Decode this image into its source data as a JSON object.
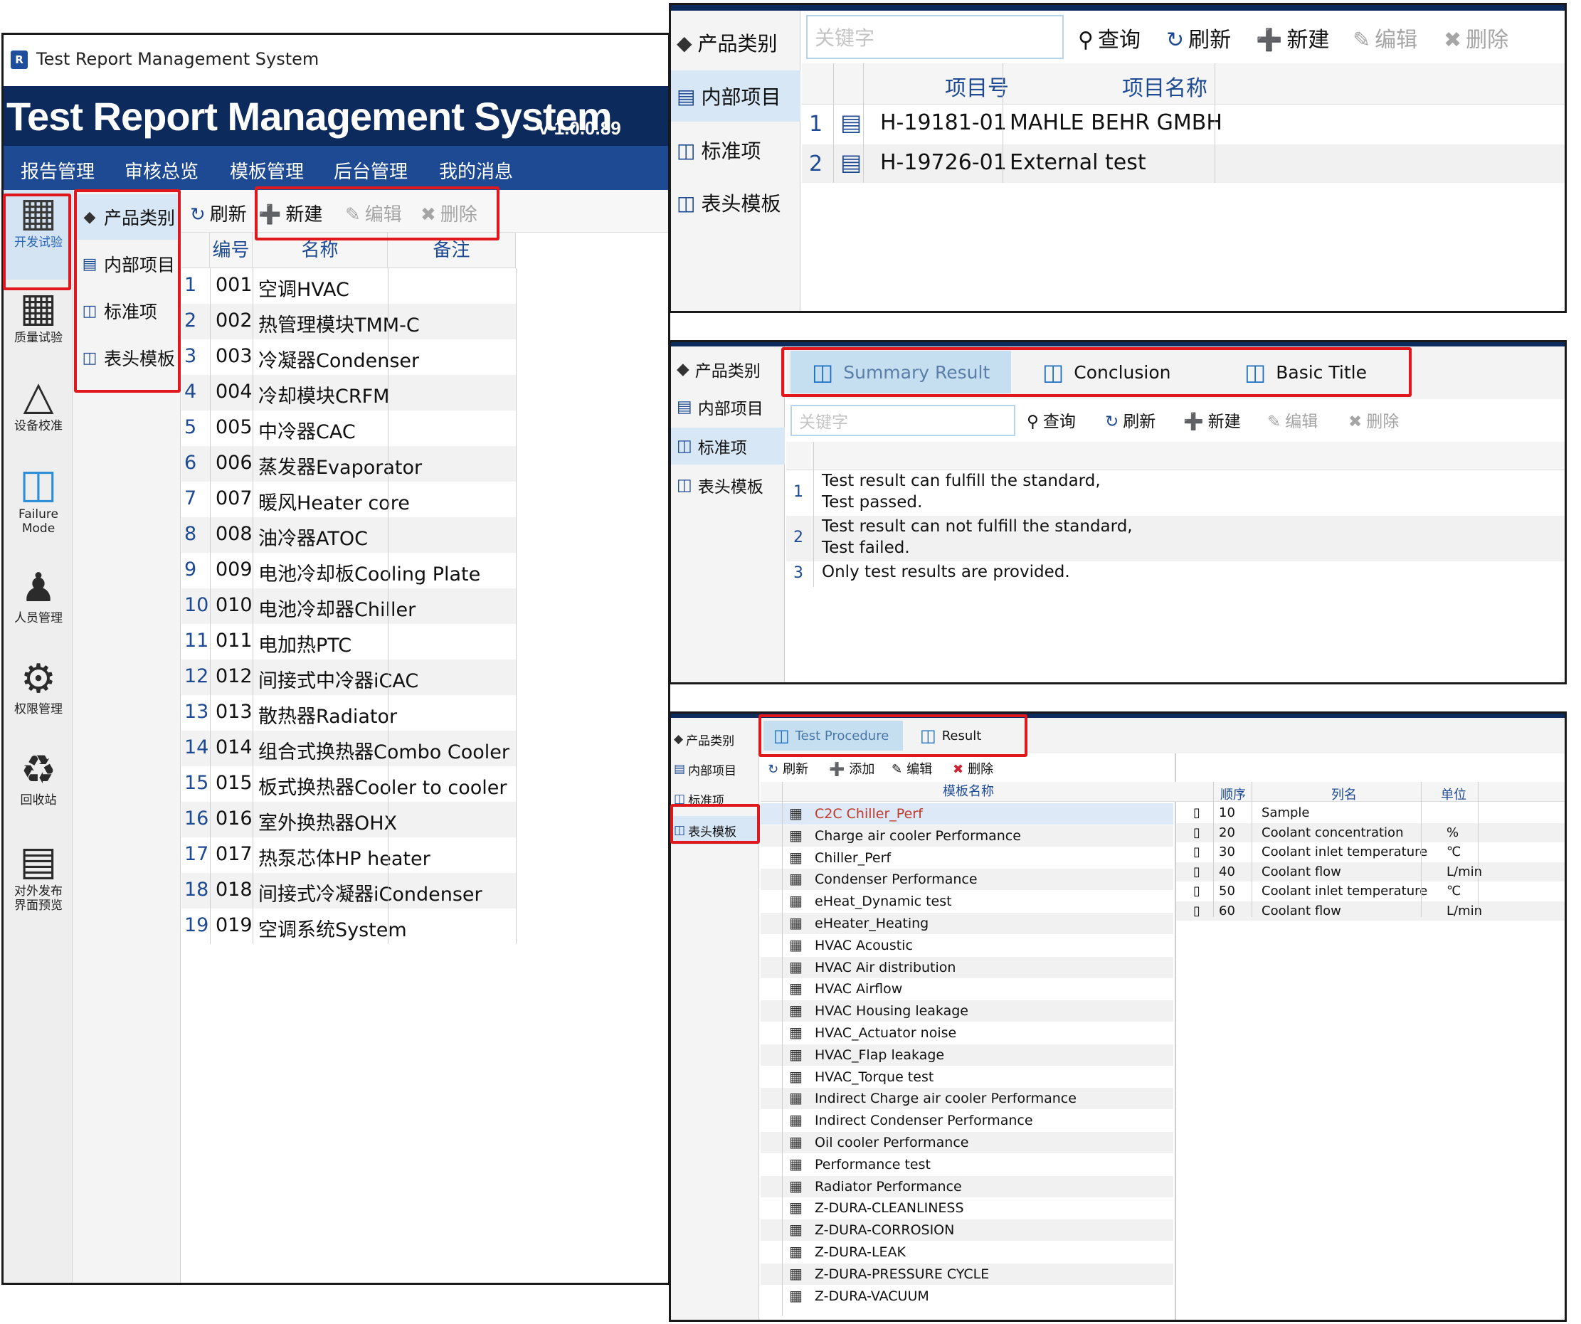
{
  "main_window": {
    "title_bar": "Test Report Management System",
    "banner": {
      "title": "Test Report Management System",
      "version": "v 1.0.0.89"
    },
    "menu": [
      "报告管理",
      "审核总览",
      "模板管理",
      "后台管理",
      "我的消息"
    ],
    "left_rail": [
      {
        "label": "开发试验",
        "icon": "building-icon",
        "active": true
      },
      {
        "label": "质量试验",
        "icon": "building-icon"
      },
      {
        "label": "设备校准",
        "icon": "compass-icon"
      },
      {
        "label": "Failure Mode",
        "icon": "database-icon"
      },
      {
        "label": "人员管理",
        "icon": "users-icon"
      },
      {
        "label": "权限管理",
        "icon": "user-gear-icon"
      },
      {
        "label": "回收站",
        "icon": "recycle-bin-icon"
      },
      {
        "label": "对外发布界面预览",
        "icon": "preview-icon"
      }
    ],
    "nav": [
      "产品类别",
      "内部项目",
      "标准项",
      "表头模板"
    ],
    "toolbar": {
      "refresh": "刷新",
      "new": "新建",
      "edit": "编辑",
      "delete": "删除"
    },
    "grid": {
      "headers": [
        "编号",
        "名称",
        "备注"
      ],
      "rows": [
        [
          "1",
          "001",
          "空调HVAC"
        ],
        [
          "2",
          "002",
          "热管理模块TMM-C"
        ],
        [
          "3",
          "003",
          "冷凝器Condenser"
        ],
        [
          "4",
          "004",
          "冷却模块CRFM"
        ],
        [
          "5",
          "005",
          "中冷器CAC"
        ],
        [
          "6",
          "006",
          "蒸发器Evaporator"
        ],
        [
          "7",
          "007",
          "暖风Heater core"
        ],
        [
          "8",
          "008",
          "油冷器ATOC"
        ],
        [
          "9",
          "009",
          "电池冷却板Cooling Plate"
        ],
        [
          "10",
          "010",
          "电池冷却器Chiller"
        ],
        [
          "11",
          "011",
          "电加热PTC"
        ],
        [
          "12",
          "012",
          "间接式中冷器iCAC"
        ],
        [
          "13",
          "013",
          "散热器Radiator"
        ],
        [
          "14",
          "014",
          "组合式换热器Combo Cooler"
        ],
        [
          "15",
          "015",
          "板式换热器Cooler to cooler"
        ],
        [
          "16",
          "016",
          "室外换热器OHX"
        ],
        [
          "17",
          "017",
          "热泵芯体HP heater"
        ],
        [
          "18",
          "018",
          "间接式冷凝器iCondenser"
        ],
        [
          "19",
          "019",
          "空调系统System"
        ]
      ]
    }
  },
  "panel_internal_projects": {
    "nav": [
      "产品类别",
      "内部项目",
      "标准项",
      "表头模板"
    ],
    "search_placeholder": "关键字",
    "toolbar": {
      "query": "查询",
      "refresh": "刷新",
      "new": "新建",
      "edit": "编辑",
      "delete": "删除"
    },
    "headers": [
      "项目号",
      "项目名称"
    ],
    "rows": [
      [
        "1",
        "H-19181-01",
        "MAHLE BEHR GMBH"
      ],
      [
        "2",
        "H-19726-01",
        "External test"
      ]
    ]
  },
  "panel_standard_items": {
    "nav": [
      "产品类别",
      "内部项目",
      "标准项",
      "表头模板"
    ],
    "tabs": [
      "Summary Result",
      "Conclusion",
      "Basic Title"
    ],
    "search_placeholder": "关键字",
    "toolbar": {
      "query": "查询",
      "refresh": "刷新",
      "new": "新建",
      "edit": "编辑",
      "delete": "删除"
    },
    "rows": [
      {
        "idx": "1",
        "line1": "Test result can fulfill the standard,",
        "line2": "Test passed."
      },
      {
        "idx": "2",
        "line1": "Test result can not fulfill the standard,",
        "line2": "Test failed."
      },
      {
        "idx": "3",
        "line1": "Only test results are provided.",
        "line2": ""
      }
    ]
  },
  "panel_header_templates": {
    "nav": [
      "产品类别",
      "内部项目",
      "标准项",
      "表头模板"
    ],
    "tabs": [
      "Test Procedure",
      "Result"
    ],
    "toolbar": {
      "refresh": "刷新",
      "add": "添加",
      "edit": "编辑",
      "delete": "删除"
    },
    "template_header": "模板名称",
    "templates": [
      "C2C Chiller_Perf",
      "Charge air cooler Performance",
      "Chiller_Perf",
      "Condenser Performance",
      "eHeat_Dynamic test",
      "eHeater_Heating",
      "HVAC Acoustic",
      "HVAC Air distribution",
      "HVAC Airflow",
      "HVAC Housing leakage",
      "HVAC_Actuator noise",
      "HVAC_Flap leakage",
      "HVAC_Torque test",
      "Indirect Charge air cooler Performance",
      "Indirect Condenser Performance",
      "Oil cooler Performance",
      "Performance test",
      "Radiator Performance",
      "Z-DURA-CLEANLINESS",
      "Z-DURA-CORROSION",
      "Z-DURA-LEAK",
      "Z-DURA-PRESSURE CYCLE",
      "Z-DURA-VACUUM"
    ],
    "column_headers": [
      "顺序",
      "列名",
      "单位"
    ],
    "columns": [
      [
        "10",
        "Sample",
        ""
      ],
      [
        "20",
        "Coolant concentration",
        "%"
      ],
      [
        "30",
        "Coolant inlet temperature",
        "℃"
      ],
      [
        "40",
        "Coolant flow",
        "L/min"
      ],
      [
        "50",
        "Coolant inlet temperature",
        "℃"
      ],
      [
        "60",
        "Coolant flow",
        "L/min"
      ]
    ]
  },
  "colors": {
    "banner": "#0d2a5c",
    "menu": "#1d4a93",
    "highlight_red": "#e0181d",
    "tab_active": "#c5dff0"
  }
}
